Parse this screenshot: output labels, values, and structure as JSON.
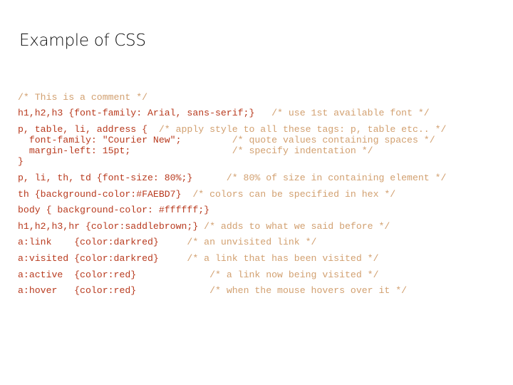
{
  "slide": {
    "title": "Example of CSS",
    "colors": {
      "code": "#b83a1e",
      "comment": "#d2a070",
      "title": "#111111"
    },
    "lines": [
      {
        "code": "",
        "comment": "/* This is a comment */"
      },
      {
        "code": "h1,h2,h3 {font-family: Arial, sans-serif;}",
        "comment": "   /* use 1st available font */"
      },
      {
        "code": "p, table, li, address {  ",
        "comment": "/* apply style to all these tags: p, table etc.. */"
      },
      {
        "code": "  font-family: \"Courier New\";",
        "comment": "         /* quote values containing spaces */"
      },
      {
        "code": "  margin-left: 15pt;",
        "comment": "                  /* specify indentation */"
      },
      {
        "code": "}",
        "comment": ""
      },
      {
        "code": "p, li, th, td {font-size: 80%;}",
        "comment": "      /* 80% of size in containing element */"
      },
      {
        "code": "th {background-color:#FAEBD7}",
        "comment": "  /* colors can be specified in hex */"
      },
      {
        "code": "body { background-color: #ffffff;}",
        "comment": ""
      },
      {
        "code": "h1,h2,h3,hr {color:saddlebrown;}",
        "comment": " /* adds to what we said before */"
      },
      {
        "code": "a:link    {color:darkred}",
        "comment": "     /* an unvisited link */"
      },
      {
        "code": "a:visited {color:darkred}",
        "comment": "     /* a link that has been visited */"
      },
      {
        "code": "a:active  {color:red}",
        "comment": "             /* a link now being visited */"
      },
      {
        "code": "a:hover   {color:red}",
        "comment": "             /* when the mouse hovers over it */"
      }
    ]
  }
}
